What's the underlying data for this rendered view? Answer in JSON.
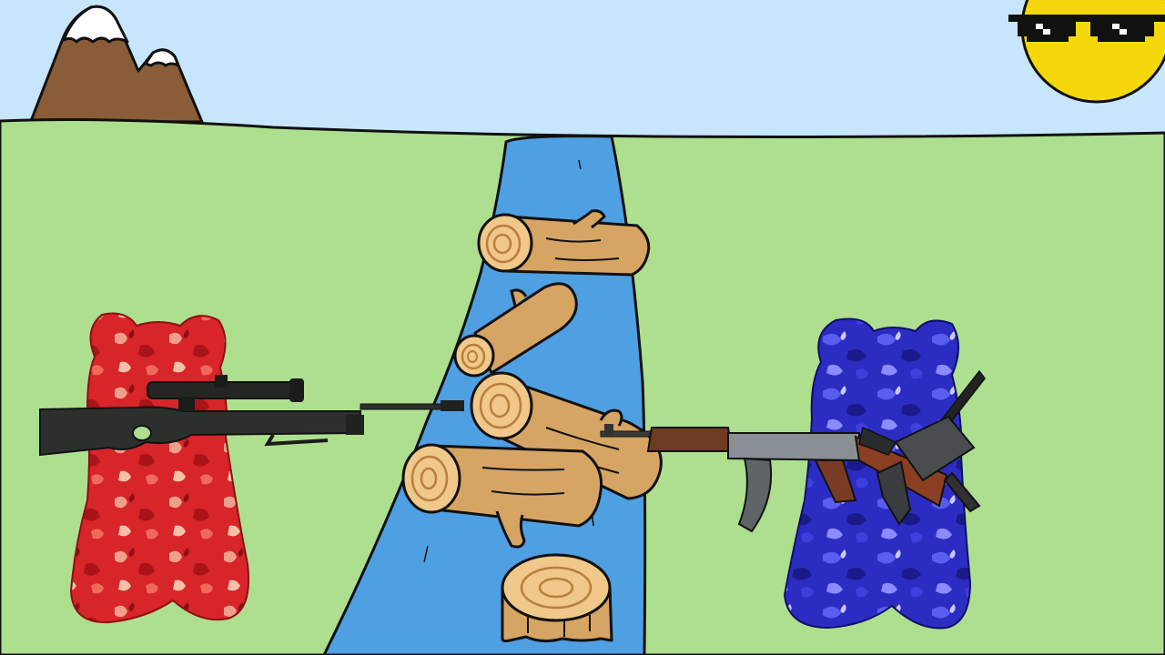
{
  "scene": {
    "colors": {
      "sky": "#c8e6fb",
      "grass": "#addf8f",
      "river": "#4f9fe3",
      "mountain": "#8a5c37",
      "snow": "#ffffff",
      "sun": "#f5d80c",
      "wood": "#d6a463",
      "wood_dark": "#b97f3c",
      "outline": "#111111",
      "red_bear": "#d7252a",
      "blue_bear": "#2b2dc2"
    },
    "icons": {
      "sun": "sun-with-pixel-sunglasses-icon",
      "mountain": "snowy-mountain-icon",
      "red_bear": "red-gummy-bear-icon",
      "blue_bear": "blue-gummy-bear-icon",
      "sniper": "sniper-rifle-icon",
      "ak": "assault-rifle-icon",
      "smg": "submachine-gun-icon",
      "log": "log-icon",
      "stump": "tree-stump-icon"
    }
  }
}
